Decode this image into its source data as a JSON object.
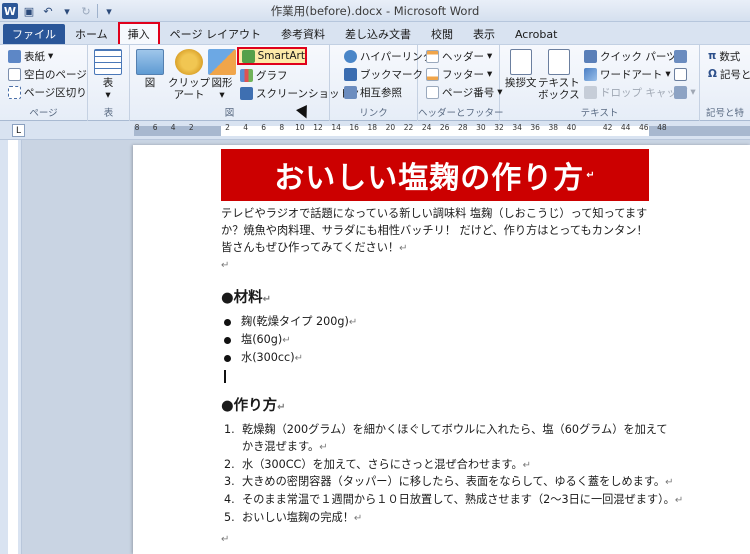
{
  "window": {
    "title": "作業用(before).docx - Microsoft Word",
    "logo": "W"
  },
  "tabs": [
    "ファイル",
    "ホーム",
    "挿入",
    "ページ レイアウト",
    "参考資料",
    "差し込み文書",
    "校閲",
    "表示",
    "Acrobat"
  ],
  "ribbon": {
    "page_group": {
      "items": [
        "表紙",
        "空白のページ",
        "ページ区切り"
      ],
      "label": "ページ"
    },
    "table_group": {
      "button": "表",
      "label": "表"
    },
    "illust_group": {
      "buttons": [
        "図",
        "クリップ\nアート",
        "図形"
      ],
      "smartart": "SmartArt",
      "graph": "グラフ",
      "screenshot": "スクリーンショット",
      "label": "図"
    },
    "link_group": {
      "items": [
        "ハイパーリンク",
        "ブックマーク",
        "相互参照"
      ],
      "label": "リンク"
    },
    "header_group": {
      "items": [
        "ヘッダー",
        "フッター",
        "ページ番号"
      ],
      "label": "ヘッダーとフッター"
    },
    "text_group": {
      "buttons": [
        "挨拶文",
        "テキスト\nボックス"
      ],
      "items": [
        "クイック パーツ",
        "ワードアート",
        "ドロップ キャップ"
      ],
      "label": "テキスト"
    },
    "symbol_group": {
      "items": [
        "数式",
        "記号とき"
      ],
      "label": "記号と特"
    }
  },
  "ruler": {
    "ticks": [
      "8",
      "6",
      "4",
      "2",
      "",
      "2",
      "4",
      "6",
      "8",
      "10",
      "12",
      "14",
      "16",
      "18",
      "20",
      "22",
      "24",
      "26",
      "28",
      "30",
      "32",
      "34",
      "36",
      "38",
      "40",
      "",
      "42",
      "44",
      "46",
      "48"
    ]
  },
  "document": {
    "title": "おいしい塩麹の作り方",
    "intro": "テレビやラジオで話題になっている新しい調味料 塩麹（しおこうじ）って知ってますか？焼魚や肉料理、サラダにも相性バッチリ！ だけど、作り方はとってもカンタン！ 皆さんもぜひ作ってみてください！",
    "materials_heading": "●材料",
    "materials": [
      "麹(乾燥タイプ 200g)",
      "塩(60g)",
      "水(300cc)"
    ],
    "method_heading": "●作り方",
    "steps": [
      {
        "num": "1.",
        "text": "乾燥麹（200グラム）を細かくほぐしてボウルに入れたら、塩（60グラム）を加えて"
      },
      {
        "num": "",
        "text": "かき混ぜます。"
      },
      {
        "num": "2.",
        "text": "水（300CC）を加えて、さらにさっと混ぜ合わせます。"
      },
      {
        "num": "3.",
        "text": "大きめの密閉容器（タッパー）に移したら、表面をならして、ゆるく蓋をしめます。"
      },
      {
        "num": "4.",
        "text": "そのまま常温で１週間から１０日放置して、熟成させます（2～3日に一回混ぜます）。"
      },
      {
        "num": "5.",
        "text": "おいしい塩麹の完成！"
      }
    ],
    "para_mark": "↵"
  },
  "colors": {
    "accent": "#cc0000",
    "file_tab": "#2a5699",
    "highlight": "#fdeaa8",
    "callout": "#e0001b"
  }
}
